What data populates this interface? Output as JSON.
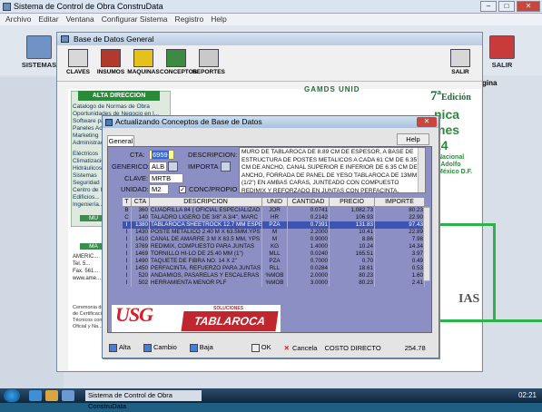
{
  "app": {
    "title": "Sistema de Control de Obra ConstruData",
    "menu": [
      "Archivo",
      "Editar",
      "Ventana",
      "Configurar Sistema",
      "Registro",
      "Help"
    ],
    "toolbar": {
      "sistemas": "SISTEMAS",
      "salir": "SALIR"
    },
    "pagina": "gina"
  },
  "bdg": {
    "title": "Base de Datos General",
    "tools": [
      "CLAVES",
      "INSUMOS",
      "MAQUINAS",
      "CONCEPTOS",
      "REPORTES"
    ],
    "salir": "SALIR"
  },
  "background": {
    "alta_direccion": "ALTA DIRECCION",
    "catalogo": "Catalogo de Normas de Obra",
    "list1": [
      "Oportunidades de Negocio en l...",
      "Software para la Construcción",
      "Paneles Acústicos",
      "Marketing",
      "Administración"
    ],
    "list2": [
      "Eléctricos",
      "Climatización",
      "Hidráulicos",
      "Sistemas",
      "Seguridad",
      "Centro de Inf...",
      "Edificios...",
      "Ingeniería..."
    ],
    "mu_label": "MU",
    "ma_label": "MA",
    "contact": [
      "AMERIC...",
      "Tel. 5...",
      "Fax. 561...",
      "www.ame..."
    ],
    "fine_print": [
      "Ceremonia de Entrega",
      "de Certificación",
      "Técnicos con",
      "Oficial y Na..."
    ],
    "seven": "7ª",
    "edicion": "Edición",
    "nica": "nica",
    "mes": "mes",
    "num14": "14",
    "nacional": "Nacional",
    "adolfo": "\"Adolfo",
    "mexico": "México D.F.",
    "gamds": "GAMDS UNID",
    "ias": "IAS"
  },
  "dialog": {
    "title": "Actualizando Conceptos de Base de Datos",
    "tab": "General",
    "help": "Help",
    "labels": {
      "cta": "CTA:",
      "descripcion": "DESCRIPCION:",
      "generico": "GENERICO:",
      "importa": "IMPORTA",
      "clave": "CLAVE:",
      "unidad": "UNIDAD:",
      "conc_propio": "CONC/PROPIO"
    },
    "values": {
      "cta": "6959",
      "generico": "ALB",
      "clave": "MRTB 009",
      "unidad": "M2",
      "conc_propio_checked": "✓"
    },
    "description": "MURO DE TABLAROCA DE 8.89 CM DE ESPESOR, A BASE DE ESTRUCTURA DE POSTES METALICOS A CADA 61 CM DE 6.35 CM DE ANCHO, CANAL SUPERIOR E INFERIOR DE 6.35 CM DE ANCHO, FORRADA DE PANEL DE YESO TABLAROCA DE 13MM (1/2\") EN AMBAS CARAS, JUNTEADO CON COMPUESTO REDIMIX Y REFORZADO EN JUNTAS CON PERFACINTA. INCLUYE",
    "table_headers": [
      "T",
      "CTA",
      "DESCRIPCION",
      "UNID",
      "CANTIDAD",
      "PRECIO",
      "IMPORTE"
    ],
    "rows": [
      [
        "B",
        "360",
        "CUADRILLA 84 ( OFICIAL ESPECIALIZAD",
        "JOR",
        "0.0741",
        "1,082.73",
        "80.23"
      ],
      [
        "C",
        "140",
        "TALADRO LIGERO DE 3/8\" A 3/4\", MARC",
        "HR",
        "0.2142",
        "106.93",
        "22.90"
      ],
      [
        "I",
        "1380",
        "TABLAROCA SHEETROCK 12.7 MM ESPE",
        "PZA",
        "0.7391",
        "131.83",
        "97.43"
      ],
      [
        "I",
        "1430",
        "POSTE METALICO 2.40 M X 63.5MM.YPS",
        "M",
        "2.2000",
        "10.41",
        "22.89"
      ],
      [
        "I",
        "1410",
        "CANAL DE AMARRE 3 M X 63.5 MM, YPS",
        "M",
        "0.9000",
        "8.86",
        "7.98"
      ],
      [
        "I",
        "3769",
        "REDIMIX, COMPUESTO PARA JUNTAS",
        "KG",
        "1.4000",
        "10.24",
        "14.34"
      ],
      [
        "I",
        "1469",
        "TORNILLO HI-LO DE 25.40 MM (1\")",
        "MLL",
        "0.0240",
        "165.51",
        "3.97"
      ],
      [
        "I",
        "1490",
        "TAQUETE DE FIBRA NO. 14 X 2\"",
        "PZA",
        "0.7000",
        "0.70",
        "0.49"
      ],
      [
        "I",
        "1450",
        "PERFACINTA, REFUERZO PARA JUNTAS",
        "RLL",
        "0.0284",
        "18.61",
        "0.53"
      ],
      [
        "I",
        "520",
        "ANDAMIOS, PASARELAS Y ESCALERAS",
        "%MOB",
        "2.0000",
        "80.23",
        "1.60"
      ],
      [
        "I",
        "502",
        "HERRAMIENTA MENOR PLF",
        "%MOB",
        "3.0000",
        "80.23",
        "2.41"
      ]
    ],
    "highlight_row": 2,
    "logos": {
      "usg": "USG",
      "tablaroca": "TABLAROCA",
      "soluciones": "SOLUCIONES"
    },
    "bottom": {
      "alta": "Alta",
      "cambio": "Cambio",
      "baja": "Baja",
      "ok": "OK",
      "cancela": "Cancela",
      "costo_label": "COSTO DIRECTO",
      "costo_value": "254.78"
    }
  },
  "taskbar": {
    "task": "Sistema de Control de Obra ConstruData",
    "clock": "02:21"
  },
  "colors": {
    "accent_green": "#2ab44a",
    "grid_bg": "#8c8fc4",
    "highlight": "#3d54b5",
    "tablaroca_red": "#c0262d"
  }
}
